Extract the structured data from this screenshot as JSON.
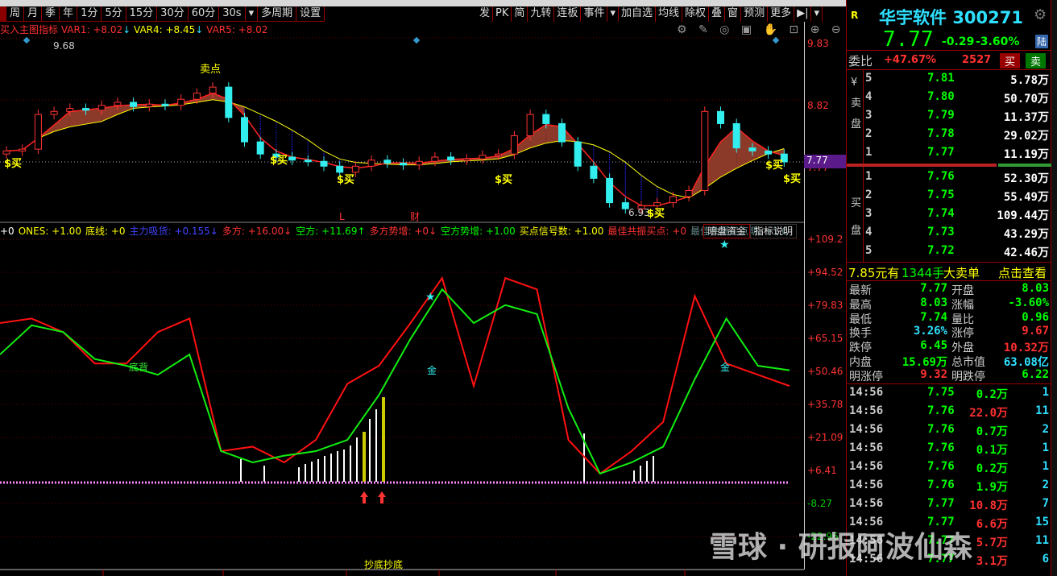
{
  "toolbar": {
    "periods": [
      "周",
      "月",
      "季",
      "年",
      "1分",
      "5分",
      "15分",
      "30分",
      "60分",
      "30s",
      "▾",
      "多周期",
      "设置"
    ],
    "right": [
      "发",
      "PK",
      "简",
      "九转",
      "连板",
      "事件",
      "▾",
      "加自选",
      "均线",
      "除权",
      "叠",
      "窗",
      "预测",
      "更多",
      "▶|",
      "▾"
    ]
  },
  "main_indicator": {
    "name": "买入主图指标",
    "var1": "VAR1: +8.02",
    "var4": "VAR4: +8.45",
    "var5": "VAR5: +8.02"
  },
  "main_axis": [
    "9.83",
    "8.82",
    "7.77"
  ],
  "main_labels": {
    "high": "9.68",
    "low": "6.93",
    "sell_point": "卖点",
    "buy": "$买",
    "L": "L",
    "cai": "财"
  },
  "sub_indicator": {
    "items": [
      {
        "t": "+0",
        "c": "#fff"
      },
      {
        "t": "ONES: +1.00",
        "c": "#ff0"
      },
      {
        "t": "底线: +0",
        "c": "#ff0"
      },
      {
        "t": "主力吸货: +0.155↓",
        "c": "#44f"
      },
      {
        "t": "多方: +16.00↓",
        "c": "#f33"
      },
      {
        "t": "空方: +11.69↑",
        "c": "#0f0"
      },
      {
        "t": "多方势增: +0↓",
        "c": "#f33"
      },
      {
        "t": "空方势增: +1.00",
        "c": "#0f0"
      },
      {
        "t": "买点信号数: +1.00",
        "c": "#ff0"
      },
      {
        "t": "最佳共振买点: +0",
        "c": "#f33"
      },
      {
        "t": "最佳共振买点期: +1.0",
        "c": "#688"
      }
    ],
    "btn_dark": "暗盘资金",
    "btn_help": "指标说明"
  },
  "sub_axis": [
    "+109.2",
    "+94.52",
    "+79.83",
    "+65.15",
    "+50.46",
    "+35.78",
    "+21.09",
    "+6.41",
    "-8.27",
    "-22.96"
  ],
  "sub_labels": {
    "gold": "金",
    "div": "底背",
    "bottom": "抄底抄底"
  },
  "chart_data": {
    "type": "line",
    "price_closes": [
      7.95,
      7.98,
      8.55,
      8.6,
      8.65,
      8.62,
      8.7,
      8.75,
      8.68,
      8.72,
      8.7,
      8.8,
      8.9,
      9.0,
      8.5,
      8.1,
      7.9,
      7.85,
      7.8,
      7.78,
      7.7,
      7.6,
      7.7,
      7.8,
      7.75,
      7.72,
      7.78,
      7.85,
      7.8,
      7.82,
      7.88,
      7.9,
      8.2,
      8.55,
      8.4,
      8.1,
      7.7,
      7.5,
      7.1,
      7.0,
      7.05,
      7.1,
      7.2,
      7.3,
      8.6,
      8.4,
      8.0,
      7.95,
      7.9,
      7.77
    ],
    "price_range": [
      6.8,
      10.0
    ],
    "red_line": [
      72,
      74,
      68,
      54,
      54,
      68,
      74,
      15,
      17,
      10,
      20,
      45,
      53,
      72,
      92,
      44,
      92,
      87,
      20,
      5,
      15,
      28,
      84,
      54,
      49,
      44
    ],
    "green_line": [
      58,
      71,
      68,
      56,
      53,
      49,
      58,
      15,
      10,
      13,
      15,
      20,
      40,
      65,
      87,
      72,
      80,
      76,
      34,
      5,
      10,
      17,
      47,
      74,
      53,
      51
    ],
    "sub_range": [
      -30,
      112
    ]
  },
  "quote": {
    "flag": "R",
    "name": "华宇软件",
    "code": "300271",
    "price": "7.77",
    "change": "-0.29",
    "pct": "-3.60%",
    "badge": "陆",
    "wb_label": "委比",
    "wb": "+47.67%",
    "wc": "2527",
    "buy": "买",
    "sell": "卖"
  },
  "book": {
    "sell_label": [
      "¥",
      "卖",
      "盘"
    ],
    "buy_label": [
      "买",
      "盘"
    ],
    "sells": [
      [
        "5",
        "7.81",
        "5.78万"
      ],
      [
        "4",
        "7.80",
        "50.70万"
      ],
      [
        "3",
        "7.79",
        "11.37万"
      ],
      [
        "2",
        "7.78",
        "29.02万"
      ],
      [
        "1",
        "7.77",
        "11.19万"
      ]
    ],
    "buys": [
      [
        "1",
        "7.76",
        "52.30万"
      ],
      [
        "2",
        "7.75",
        "55.49万"
      ],
      [
        "3",
        "7.74",
        "109.44万"
      ],
      [
        "4",
        "7.73",
        "43.29万"
      ],
      [
        "5",
        "7.72",
        "42.46万"
      ]
    ]
  },
  "bigorder": {
    "a": "7.85元有",
    "b": "1344手",
    "c": "大卖单",
    "d": "点击查看"
  },
  "stats": [
    [
      "最新",
      "7.77",
      "开盘",
      "8.03"
    ],
    [
      "最高",
      "8.03",
      "涨幅",
      "-3.60%"
    ],
    [
      "最低",
      "7.74",
      "量比",
      "0.96"
    ],
    [
      "换手",
      "3.26%",
      "涨停",
      "9.67"
    ],
    [
      "跌停",
      "6.45",
      "外盘",
      "10.32万"
    ],
    [
      "内盘",
      "15.69万",
      "总市值",
      "63.08亿"
    ],
    [
      "明涨停",
      "9.32",
      "明跌停",
      "6.22"
    ]
  ],
  "ticks": [
    [
      "14:56",
      "7.75",
      "0.2万",
      "1"
    ],
    [
      "14:56",
      "7.76",
      "22.0万",
      "11"
    ],
    [
      "14:56",
      "7.76",
      "0.7万",
      "2"
    ],
    [
      "14:56",
      "7.76",
      "0.1万",
      "1"
    ],
    [
      "14:56",
      "7.76",
      "0.2万",
      "1"
    ],
    [
      "14:56",
      "7.76",
      "1.9万",
      "2"
    ],
    [
      "14:56",
      "7.77",
      "10.8万",
      "7"
    ],
    [
      "14:56",
      "7.77",
      "6.6万",
      "15"
    ],
    [
      "14:56",
      "7.77",
      "5.7万",
      "11"
    ],
    [
      "14:56",
      "7.77",
      "3.1万",
      "6"
    ]
  ],
  "watermark": "雪球 · 研报阿波仙森"
}
